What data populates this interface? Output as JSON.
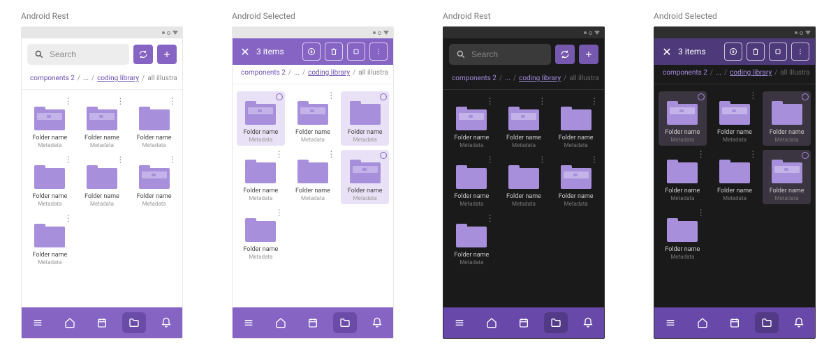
{
  "variants": [
    {
      "label": "Android Rest",
      "mode": "rest",
      "theme": "light"
    },
    {
      "label": "Android Selected",
      "mode": "selected",
      "theme": "light"
    },
    {
      "label": "Android Rest",
      "mode": "rest",
      "theme": "dark"
    },
    {
      "label": "Android Selected",
      "mode": "selected",
      "theme": "dark"
    }
  ],
  "search_placeholder": "Search",
  "selection": {
    "count_label": "3 items"
  },
  "breadcrumbs": {
    "c1": "components 2",
    "c2": "...",
    "c3": "coding library",
    "c4": "all illustra"
  },
  "tile_defaults": {
    "name": "Folder name",
    "meta": "Metadata"
  },
  "tiles": [
    {
      "flap": true,
      "selected": true
    },
    {
      "flap": true,
      "selected": false
    },
    {
      "flap": false,
      "selected": true
    },
    {
      "flap": false,
      "selected": false
    },
    {
      "flap": false,
      "selected": false
    },
    {
      "flap": true,
      "selected": true
    },
    {
      "flap": false,
      "selected": false
    }
  ],
  "icons": {
    "search": "search-icon",
    "sync": "sync-icon",
    "plus": "plus-icon",
    "download": "download-circle-icon",
    "trash": "trash-icon",
    "stop": "square-outline-icon",
    "more_v": "more-vert-icon",
    "close": "close-icon",
    "menu": "menu-icon",
    "home": "home-icon",
    "calendar": "calendar-icon",
    "folder": "folder-icon",
    "bell": "bell-icon"
  }
}
